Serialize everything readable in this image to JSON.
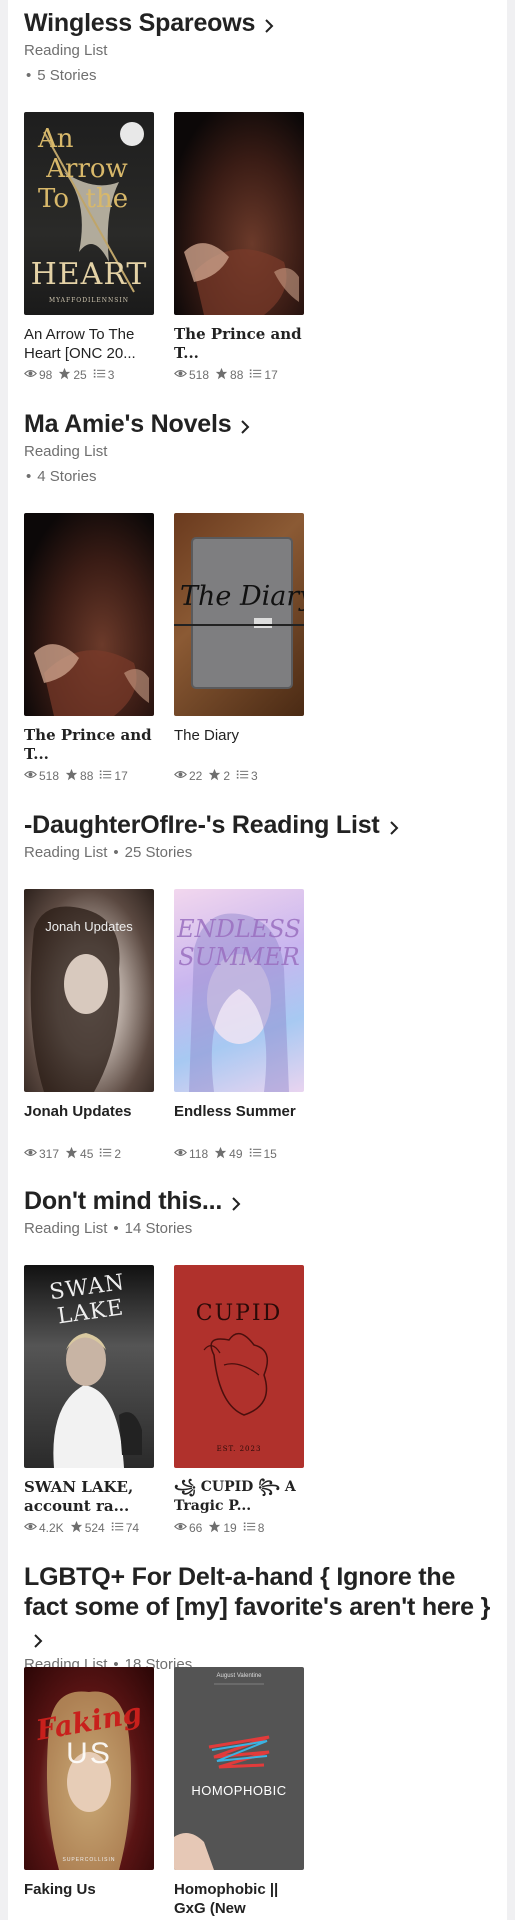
{
  "lists": [
    {
      "title": "Wingless Spareows",
      "type": "Reading List",
      "count": "5 Stories",
      "books": [
        {
          "title": "An Arrow To The Heart [ONC 20...",
          "reads": "98",
          "votes": "25",
          "parts": "3",
          "cover_text": "An Arrow To the HEART",
          "cover_author": "MYAFFODILENNSIN"
        },
        {
          "title": "The Prince and T...",
          "reads": "518",
          "votes": "88",
          "parts": "17"
        }
      ]
    },
    {
      "title": "Ma Amie's Novels",
      "type": "Reading List",
      "count": "4 Stories",
      "books": [
        {
          "title": "The Prince and T...",
          "reads": "518",
          "votes": "88",
          "parts": "17"
        },
        {
          "title": "The Diary",
          "reads": "22",
          "votes": "2",
          "parts": "3",
          "cover_text": "The Diary"
        }
      ]
    },
    {
      "title": "-DaughterOfIre-'s Reading List",
      "type": "Reading List",
      "count": "25 Stories",
      "books": [
        {
          "title": "Jonah Updates",
          "reads": "317",
          "votes": "45",
          "parts": "2",
          "cover_text": "Jonah Updates"
        },
        {
          "title": "Endless Summer",
          "reads": "118",
          "votes": "49",
          "parts": "15",
          "cover_text": "ENDLESS SUMMER"
        }
      ]
    },
    {
      "title": "Don't mind this...",
      "type": "Reading List",
      "count": "14 Stories",
      "books": [
        {
          "title": "SWAN LAKE, account ra...",
          "reads": "4.2K",
          "votes": "524",
          "parts": "74",
          "cover_text": "SWAN LAKE"
        },
        {
          "title": "꧁ CUPID ꧂ A Tragic P...",
          "reads": "66",
          "votes": "19",
          "parts": "8",
          "cover_text": "CUPID",
          "cover_sub": "EST. 2023"
        }
      ]
    },
    {
      "title": "LGBTQ+ For Delt-a-hand { Ignore the fact some of [my] favorite's aren't here }",
      "type": "Reading List",
      "count": "18 Stories",
      "books": [
        {
          "title": "Faking Us",
          "cover_text": "Faking US",
          "cover_author": "SUPERCOLLISIN"
        },
        {
          "title": "Homophobic || GxG (New versio...",
          "cover_text": "HOMOPHOBIC",
          "cover_author": "August Valentine"
        }
      ]
    }
  ],
  "colors": {
    "background": "#ffffff",
    "meta": "#6f6f6f",
    "title": "#222222"
  }
}
